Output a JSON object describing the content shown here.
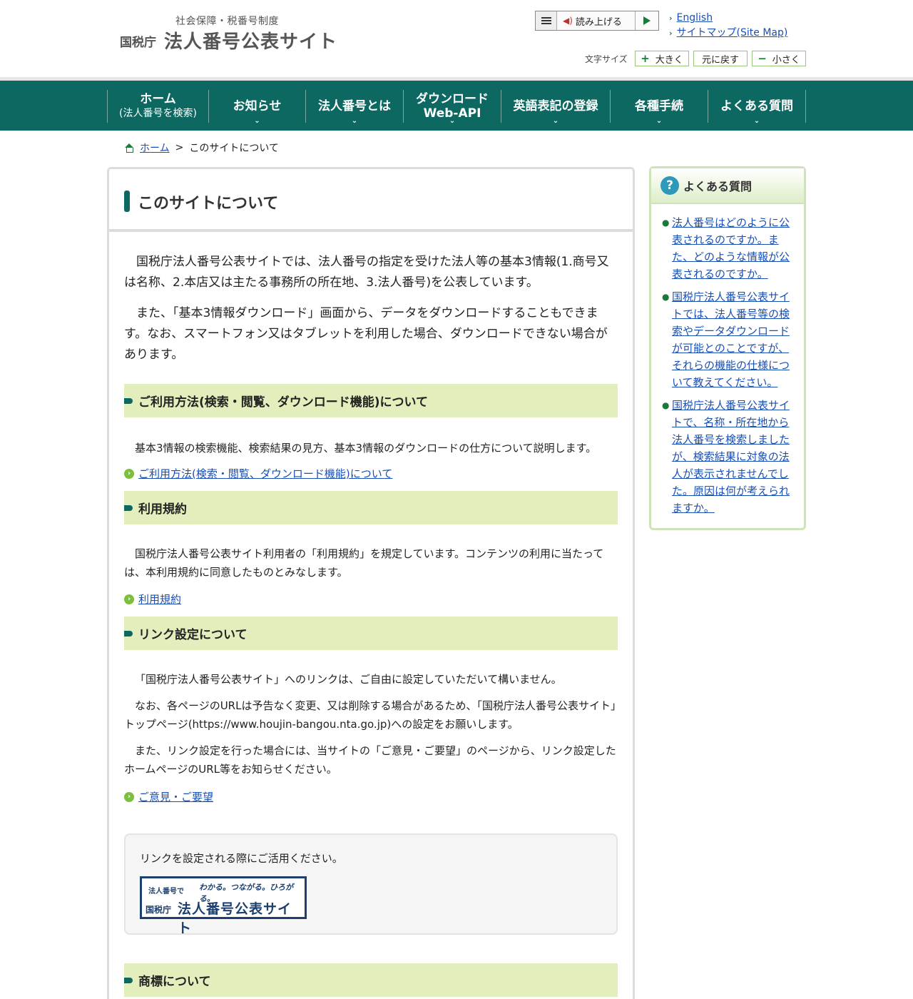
{
  "header": {
    "logo_sub": "社会保障・税番号制度",
    "logo_agency": "国税庁",
    "logo_title": "法人番号公表サイト",
    "read_aloud_label": "読み上げる",
    "links": [
      "English",
      "サイトマップ(Site Map)"
    ],
    "font_size_label": "文字サイズ",
    "font_size_buttons": [
      "大きく",
      "元に戻す",
      "小さく"
    ]
  },
  "nav": {
    "items": [
      {
        "line1": "ホーム",
        "line2": "(法人番号を検索)"
      },
      {
        "line1": "お知らせ",
        "line2": ""
      },
      {
        "line1": "法人番号とは",
        "line2": ""
      },
      {
        "line1": "ダウンロード",
        "line2": "Web-API"
      },
      {
        "line1": "英語表記の登録",
        "line2": ""
      },
      {
        "line1": "各種手続",
        "line2": ""
      },
      {
        "line1": "よくある質問",
        "line2": ""
      }
    ]
  },
  "breadcrumb": {
    "home": "ホーム",
    "separator": ">",
    "current": "このサイトについて"
  },
  "main": {
    "title": "このサイトについて",
    "intro": [
      "国税庁法人番号公表サイトでは、法人番号の指定を受けた法人等の基本3情報(1.商号又は名称、2.本店又は主たる事務所の所在地、3.法人番号)を公表しています。",
      "また、「基本3情報ダウンロード」画面から、データをダウンロードすることもできます。なお、スマートフォン又はタブレットを利用した場合、ダウンロードできない場合があります。"
    ],
    "sections": [
      {
        "heading": "ご利用方法(検索・閲覧、ダウンロード機能)について",
        "body": [
          "基本3情報の検索機能、検索結果の見方、基本3情報のダウンロードの仕方について説明します。"
        ],
        "link": "ご利用方法(検索・閲覧、ダウンロード機能)について"
      },
      {
        "heading": "利用規約",
        "body": [
          "国税庁法人番号公表サイト利用者の「利用規約」を規定しています。コンテンツの利用に当たっては、本利用規約に同意したものとみなします。"
        ],
        "link": "利用規約"
      },
      {
        "heading": "リンク設定について",
        "body": [
          "「国税庁法人番号公表サイト」へのリンクは、ご自由に設定していただいて構いません。",
          "なお、各ページのURLは予告なく変更、又は削除する場合があるため、「国税庁法人番号公表サイト」トップページ(https://www.houjin-bangou.nta.go.jp)への設定をお願いします。",
          "また、リンク設定を行った場合には、当サイトの「ご意見・ご要望」のページから、リンク設定したホームページのURL等をお知らせください。"
        ],
        "link": "ご意見・ご要望"
      },
      {
        "heading": "商標について"
      }
    ],
    "banner": {
      "note": "リンクを設定される際にご活用ください。",
      "top_text": "法人番号で",
      "tagline": "わかる。つながる。ひろがる。",
      "agency": "国税庁",
      "title": "法人番号公表サイト"
    }
  },
  "sidebar": {
    "title": "よくある質問",
    "items": [
      "法人番号はどのように公表されるのですか。また、どのような情報が公表されるのですか。",
      "国税庁法人番号公表サイトでは、法人番号等の検索やデータダウンロードが可能とのことですが、それらの機能の仕様について教えてください。",
      "国税庁法人番号公表サイトで、名称・所在地から法人番号を検索しましたが、検索結果に対象の法人が表示されませんでした。原因は何が考えられますか。"
    ]
  }
}
